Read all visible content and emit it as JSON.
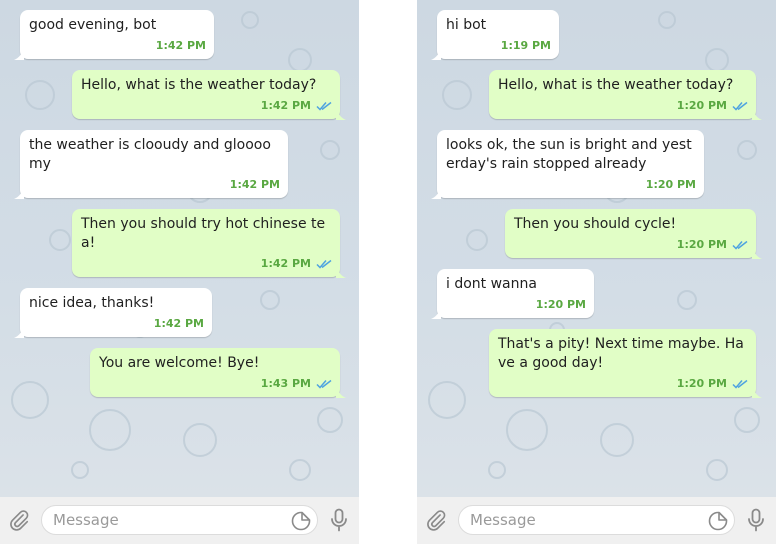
{
  "colors": {
    "incoming_bubble": "#ffffff",
    "outgoing_bubble": "#e1fec6",
    "time_text": "#5aa842",
    "read_ticks": "#4fa3e0",
    "wallpaper": "#cfd9e3",
    "composer_bg": "#f0f0f0"
  },
  "chats": [
    {
      "messages": [
        {
          "direction": "in",
          "text": "good evening, bot",
          "time": "1:42 PM",
          "read": false
        },
        {
          "direction": "out",
          "text": "Hello, what is the weather today?",
          "time": "1:42 PM",
          "read": true
        },
        {
          "direction": "in",
          "text": "the weather is clooudy and gloooo\nmy",
          "time": "1:42 PM",
          "read": false
        },
        {
          "direction": "out",
          "text": "Then you should try hot chinese te\na!",
          "time": "1:42 PM",
          "read": true
        },
        {
          "direction": "in",
          "text": "nice idea, thanks!",
          "time": "1:42 PM",
          "read": false
        },
        {
          "direction": "out",
          "text": "You are welcome! Bye!",
          "time": "1:43 PM",
          "read": true
        }
      ],
      "composer": {
        "placeholder": "Message"
      }
    },
    {
      "messages": [
        {
          "direction": "in",
          "text": "hi bot",
          "time": "1:19 PM",
          "read": false
        },
        {
          "direction": "out",
          "text": "Hello, what is the weather today?",
          "time": "1:20 PM",
          "read": true
        },
        {
          "direction": "in",
          "text": "looks ok, the sun is bright and yest\nerday's rain stopped already",
          "time": "1:20 PM",
          "read": false
        },
        {
          "direction": "out",
          "text": "Then you should cycle!",
          "time": "1:20 PM",
          "read": true
        },
        {
          "direction": "in",
          "text": "i dont wanna",
          "time": "1:20 PM",
          "read": false
        },
        {
          "direction": "out",
          "text": "That's a pity! Next time maybe. Ha\nve a good day!",
          "time": "1:20 PM",
          "read": true
        }
      ],
      "composer": {
        "placeholder": "Message"
      }
    }
  ],
  "icons": {
    "attach": "paperclip-icon",
    "sticker": "sticker-icon",
    "mic": "microphone-icon",
    "read": "double-check-icon"
  }
}
